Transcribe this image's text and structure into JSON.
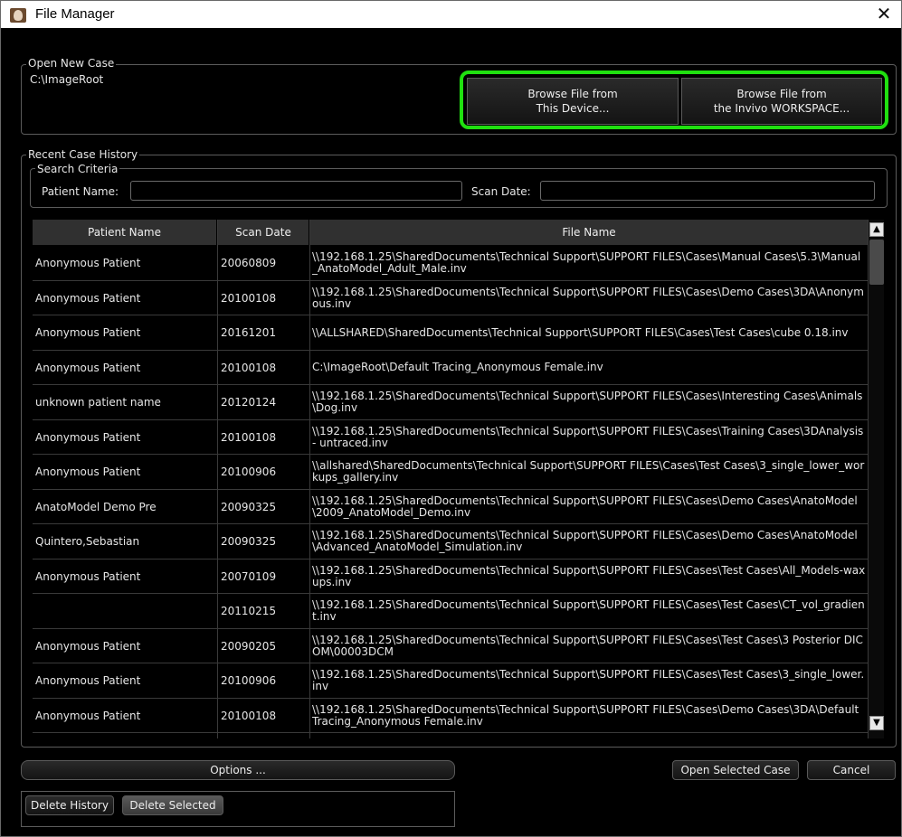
{
  "window": {
    "title": "File Manager",
    "close_glyph": "✕",
    "icon": "app-icon"
  },
  "open_new_case": {
    "legend": "Open New Case",
    "current_path": "C:\\ImageRoot",
    "browse_device_line1": "Browse File from",
    "browse_device_line2": "This Device...",
    "browse_workspace_line1": "Browse File from",
    "browse_workspace_line2": "the Invivo WORKSPACE...",
    "highlight_color": "#20e010"
  },
  "recent": {
    "legend": "Recent Case History",
    "search": {
      "legend": "Search Criteria",
      "patient_name_label": "Patient Name:",
      "patient_name_value": "",
      "scan_date_label": "Scan Date:",
      "scan_date_value": ""
    },
    "columns": [
      "Patient Name",
      "Scan Date",
      "File Name"
    ],
    "rows": [
      {
        "name": "Anonymous Patient",
        "date": "20060809",
        "file": "\\\\192.168.1.25\\SharedDocuments\\Technical Support\\SUPPORT FILES\\Cases\\Manual Cases\\5.3\\Manual_AnatoModel_Adult_Male.inv"
      },
      {
        "name": "Anonymous Patient",
        "date": "20100108",
        "file": "\\\\192.168.1.25\\SharedDocuments\\Technical Support\\SUPPORT FILES\\Cases\\Demo Cases\\3DA\\Anonymous.inv"
      },
      {
        "name": "Anonymous Patient",
        "date": "20161201",
        "file": "\\\\ALLSHARED\\SharedDocuments\\Technical Support\\SUPPORT FILES\\Cases\\Test Cases\\cube 0.18.inv"
      },
      {
        "name": "Anonymous Patient",
        "date": "20100108",
        "file": "C:\\ImageRoot\\Default Tracing_Anonymous Female.inv"
      },
      {
        "name": "unknown patient name",
        "date": "20120124",
        "file": "\\\\192.168.1.25\\SharedDocuments\\Technical Support\\SUPPORT FILES\\Cases\\Interesting Cases\\Animals\\Dog.inv"
      },
      {
        "name": "Anonymous Patient",
        "date": "20100108",
        "file": "\\\\192.168.1.25\\SharedDocuments\\Technical Support\\SUPPORT FILES\\Cases\\Training Cases\\3DAnalysis - untraced.inv"
      },
      {
        "name": "Anonymous Patient",
        "date": "20100906",
        "file": "\\\\allshared\\SharedDocuments\\Technical Support\\SUPPORT FILES\\Cases\\Test Cases\\3_single_lower_workups_gallery.inv"
      },
      {
        "name": "AnatoModel Demo Pre",
        "date": "20090325",
        "file": "\\\\192.168.1.25\\SharedDocuments\\Technical Support\\SUPPORT FILES\\Cases\\Demo Cases\\AnatoModel\\2009_AnatoModel_Demo.inv"
      },
      {
        "name": "Quintero,Sebastian",
        "date": "20090325",
        "file": "\\\\192.168.1.25\\SharedDocuments\\Technical Support\\SUPPORT FILES\\Cases\\Demo Cases\\AnatoModel\\Advanced_AnatoModel_Simulation.inv"
      },
      {
        "name": "Anonymous Patient",
        "date": "20070109",
        "file": "\\\\192.168.1.25\\SharedDocuments\\Technical Support\\SUPPORT FILES\\Cases\\Test Cases\\All_Models-waxups.inv"
      },
      {
        "name": "",
        "date": "20110215",
        "file": "\\\\192.168.1.25\\SharedDocuments\\Technical Support\\SUPPORT FILES\\Cases\\Test Cases\\CT_vol_gradient.inv"
      },
      {
        "name": "Anonymous Patient",
        "date": "20090205",
        "file": "\\\\192.168.1.25\\SharedDocuments\\Technical Support\\SUPPORT FILES\\Cases\\Test Cases\\3 Posterior DICOM\\00003DCM"
      },
      {
        "name": "Anonymous Patient",
        "date": "20100906",
        "file": "\\\\192.168.1.25\\SharedDocuments\\Technical Support\\SUPPORT FILES\\Cases\\Test Cases\\3_single_lower.inv"
      },
      {
        "name": "Anonymous Patient",
        "date": "20100108",
        "file": "\\\\192.168.1.25\\SharedDocuments\\Technical Support\\SUPPORT FILES\\Cases\\Demo Cases\\3DA\\Default Tracing_Anonymous Female.inv"
      }
    ]
  },
  "footer": {
    "options_label": "Options ...",
    "open_selected_label": "Open Selected Case",
    "cancel_label": "Cancel",
    "delete_history_label": "Delete History",
    "delete_selected_label": "Delete Selected"
  },
  "scrollbar": {
    "up_glyph": "▲",
    "down_glyph": "▼"
  }
}
